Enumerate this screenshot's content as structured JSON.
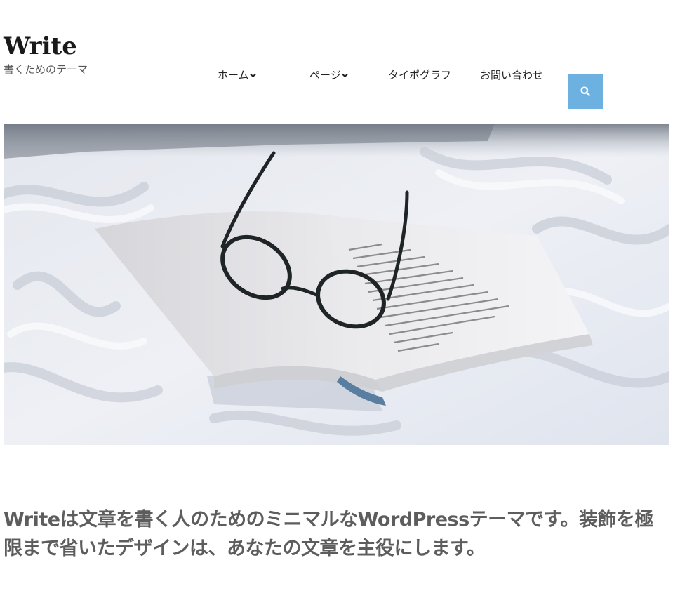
{
  "header": {
    "site_title": "Write",
    "site_description": "書くためのテーマ"
  },
  "nav": {
    "items": [
      {
        "label": "ホーム",
        "has_dropdown": true
      },
      {
        "label": "ページ",
        "has_dropdown": true
      },
      {
        "label": "タイポグラフ",
        "has_dropdown": false
      },
      {
        "label": "お問い合わせ",
        "has_dropdown": false
      }
    ]
  },
  "search": {
    "icon": "search-icon",
    "color": "#6cb1e0"
  },
  "hero": {
    "subject": "open book with eyeglasses on white bed sheets"
  },
  "intro": {
    "text": "Writeは文章を書く人のためのミニマルなWordPressテーマです。装飾を極限まで省いたデザインは、あなたの文章を主役にします。"
  }
}
